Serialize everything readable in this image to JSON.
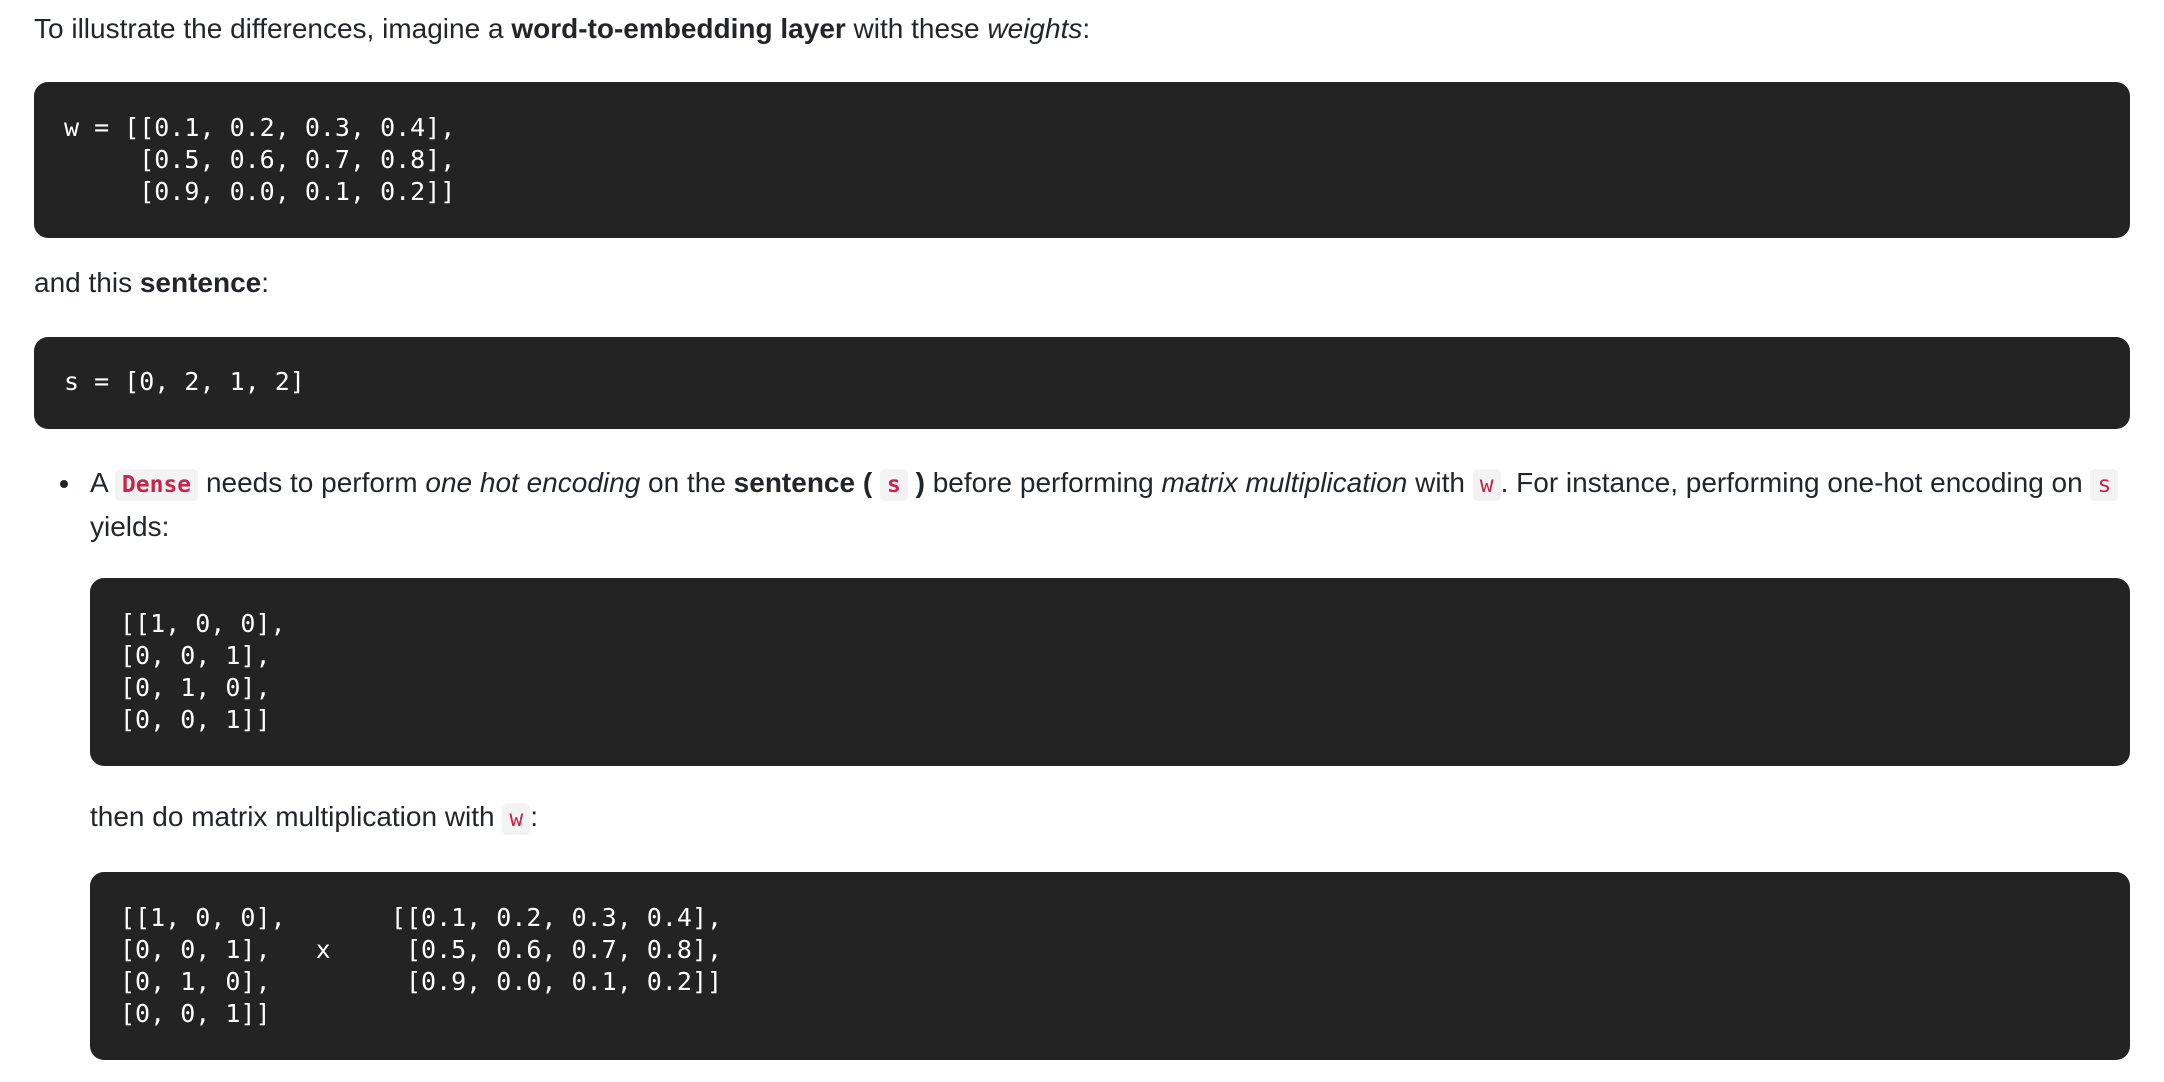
{
  "intro": {
    "text_before": "To illustrate the differences, imagine a ",
    "bold": "word-to-embedding layer",
    "text_middle": " with these ",
    "italic": "weights",
    "text_after": ":"
  },
  "weights_code": "w = [[0.1, 0.2, 0.3, 0.4],\n     [0.5, 0.6, 0.7, 0.8],\n     [0.9, 0.0, 0.1, 0.2]]",
  "sentence_intro": {
    "text_before": "and this ",
    "bold": "sentence",
    "text_after": ":"
  },
  "sentence_code": "s = [0, 2, 1, 2]",
  "bullet": {
    "t1": "A ",
    "code_dense": "Dense",
    "t2": " needs to perform ",
    "i1": "one hot encoding",
    "t3": " on the ",
    "b1": "sentence (",
    "code_s": "s",
    "b2": ")",
    "t4": " before performing ",
    "i2": "matrix multiplication",
    "t5": " with ",
    "code_w": "w",
    "t6": ". For instance, performing one-hot encoding on ",
    "code_s2": "s",
    "t7": " yields:"
  },
  "onehot_code": "[[1, 0, 0],\n[0, 0, 1],\n[0, 1, 0],\n[0, 0, 1]]",
  "then_text": {
    "text_before": "then do matrix multiplication with ",
    "code_w": "w",
    "text_after": ":"
  },
  "matmul_code": "[[1, 0, 0],       [[0.1, 0.2, 0.3, 0.4],\n[0, 0, 1],   x     [0.5, 0.6, 0.7, 0.8],\n[0, 1, 0],         [0.9, 0.0, 0.1, 0.2]]\n[0, 0, 1]]"
}
